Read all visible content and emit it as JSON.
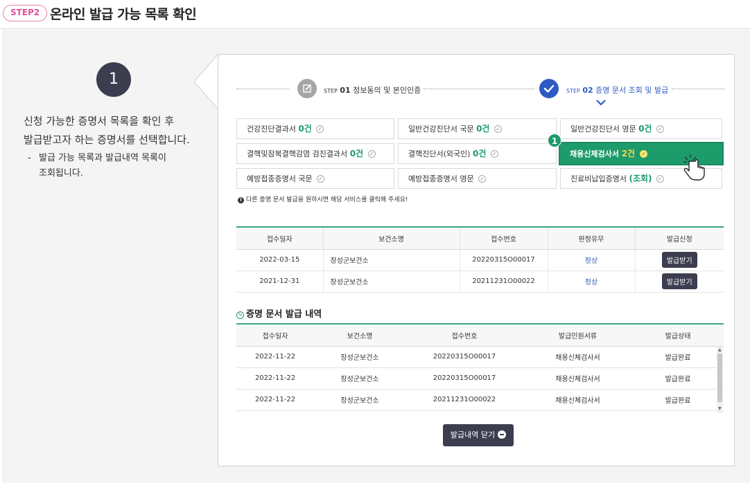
{
  "header": {
    "step_badge": "STEP2",
    "title": "온라인 발급 가능 목록 확인"
  },
  "guide": {
    "number": "1",
    "description_line1": "신청 가능한 증명서 목록을 확인 후",
    "description_line2": "발급받고자 하는 증명서를 선택합니다.",
    "sub_dash": "-",
    "sub_line1": "발급 가능 목록과 발급내역 목록이",
    "sub_line2": "조회됩니다."
  },
  "steps": [
    {
      "small": "STEP",
      "num": "01",
      "label": "정보동의 및 본인인증",
      "state": "done",
      "icon": "pencil-icon"
    },
    {
      "small": "STEP",
      "num": "02",
      "label": "증명 문서 조회 및 발급",
      "state": "active",
      "icon": "check-icon"
    }
  ],
  "certificates": [
    {
      "name": "건강진단결과서",
      "count": "0건"
    },
    {
      "name": "일반건강진단서 국문",
      "count": "0건"
    },
    {
      "name": "일반건강진단서 영문",
      "count": "0건"
    },
    {
      "name": "결핵및잠복결핵감염 검진결과서",
      "count": "0건"
    },
    {
      "name": "결핵진단서(외국인)",
      "count": "0건"
    },
    {
      "name": "채용신체검사서",
      "count": "2건"
    },
    {
      "name": "예방접종증명서 국문",
      "count": ""
    },
    {
      "name": "예방접종증명서 영문",
      "count": ""
    },
    {
      "name": "진료비납입증명서",
      "count": "(조회)"
    }
  ],
  "selected_badge": "1",
  "notice": {
    "icon": "!",
    "text": "다른 증명 문서 발급을 원하시면 해당 서비스를 클릭해 주세요!"
  },
  "issue_table": {
    "headers": [
      "접수일자",
      "보건소명",
      "접수번호",
      "판정유무",
      "발급신청"
    ],
    "rows": [
      {
        "date": "2022-03-15",
        "center": "장성군보건소",
        "receipt": "20220315O00017",
        "verdict": "정상",
        "action": "발급받기"
      },
      {
        "date": "2021-12-31",
        "center": "장성군보건소",
        "receipt": "20211231O00022",
        "verdict": "정상",
        "action": "발급받기"
      }
    ]
  },
  "history": {
    "title": "증명 문서 발급 내역",
    "headers": [
      "접수일자",
      "보건소명",
      "접수번호",
      "발급민원서류",
      "발급상태"
    ],
    "rows": [
      {
        "date": "2022-11-22",
        "center": "장성군보건소",
        "receipt": "20220315O00017",
        "doc": "채용신체검사서",
        "status": "발급완료"
      },
      {
        "date": "2022-11-22",
        "center": "장성군보건소",
        "receipt": "20220315O00017",
        "doc": "채용신체검사서",
        "status": "발급완료"
      },
      {
        "date": "2022-11-22",
        "center": "장성군보건소",
        "receipt": "20211231O00022",
        "doc": "채용신체검사서",
        "status": "발급완료"
      }
    ]
  },
  "close_button": "발급내역 닫기",
  "colors": {
    "accent": "#1e9b6b",
    "dark": "#3c3d4f",
    "pink": "#e0529b",
    "link": "#2a5db0"
  }
}
